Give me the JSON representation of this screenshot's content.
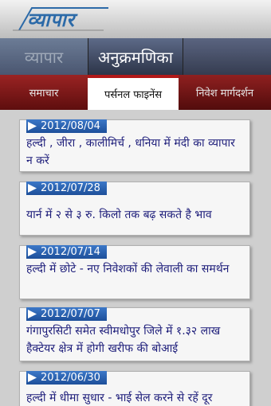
{
  "header": {
    "logo_text": "व्यापार"
  },
  "main_tabs": [
    "व्यापार",
    "अनुक्रमणिका",
    ""
  ],
  "sub_tabs": [
    "समाचार",
    "पर्सनल फाइनेंस",
    "निवेश मार्गदर्शन"
  ],
  "articles": [
    {
      "date": "2012/08/04",
      "title": "हल्दी , जीरा , कालीमिर्च , धनिया में मंदी का व्यापार न करें"
    },
    {
      "date": "2012/07/28",
      "title": "यार्न में २ से ३ रु. किलो तक बढ़ सकते है भाव"
    },
    {
      "date": "2012/07/14",
      "title": "हल्दी में छोटे - नए निवेशकों की लेवाली का समर्थन"
    },
    {
      "date": "2012/07/07",
      "title": "गंगापुरसिटी समेत स्वीमधोपुर जिले में १.३२ लाख हैक्टेयर क्षेत्र में होगी खरीफ की बोआई"
    },
    {
      "date": "2012/06/30",
      "title": "हल्दी में धीमा सुधार - भाई सेल करने से रहें दूर"
    }
  ]
}
